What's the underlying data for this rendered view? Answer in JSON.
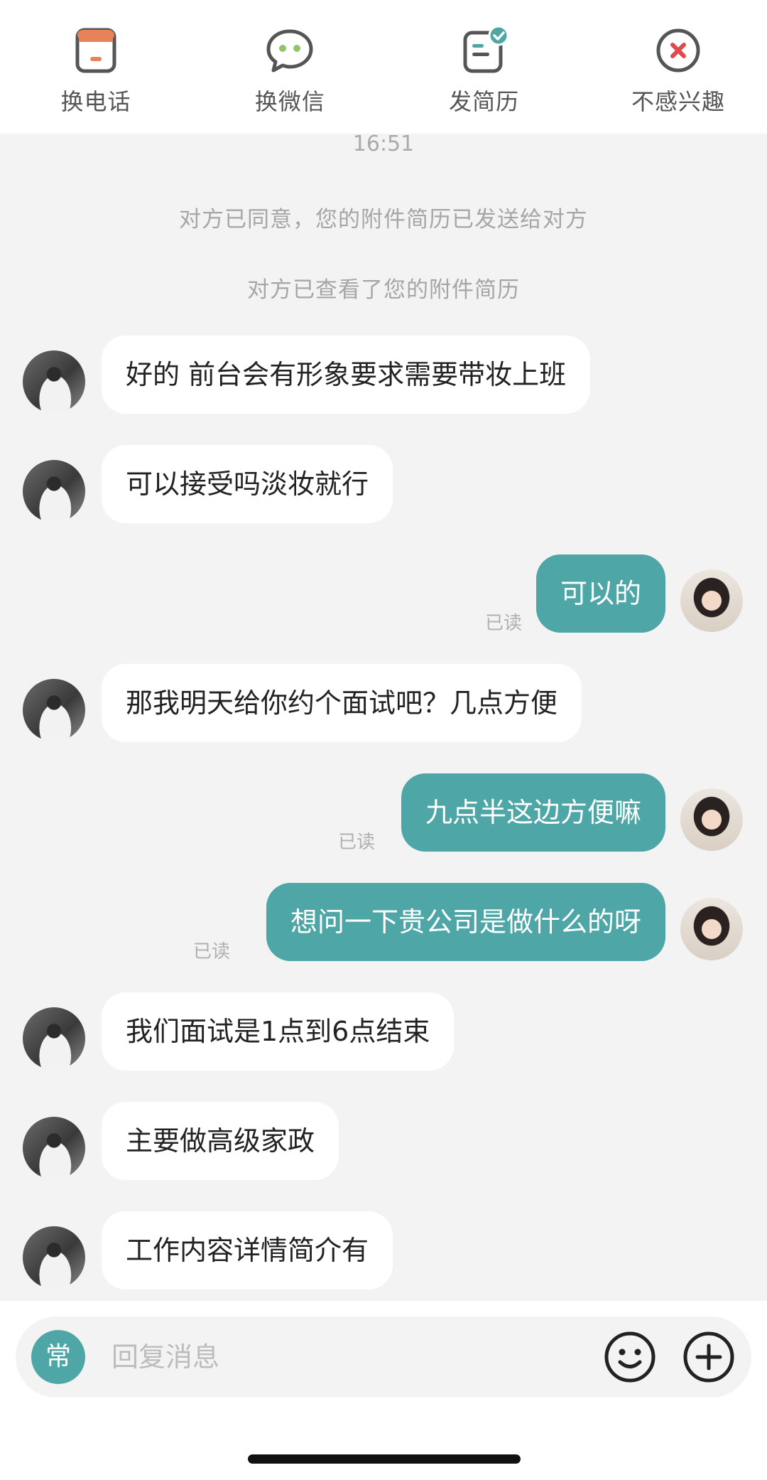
{
  "actions": {
    "phone": "换电话",
    "wechat": "换微信",
    "resume": "发简历",
    "not_interested": "不感兴趣"
  },
  "colors": {
    "accent": "#4fa6a6",
    "orange": "#e8825a",
    "green": "#8fc46a",
    "red": "#e04a4a"
  },
  "chat": {
    "timestamp": "16:51",
    "system": [
      "对方已同意，您的附件简历已发送给对方",
      "对方已查看了您的附件简历"
    ],
    "messages": [
      {
        "from": "other",
        "text": "好的 前台会有形象要求需要带妆上班"
      },
      {
        "from": "other",
        "text": "可以接受吗淡妆就行"
      },
      {
        "from": "me",
        "text": "可以的",
        "status": "已读"
      },
      {
        "from": "other",
        "text": "那我明天给你约个面试吧？几点方便"
      },
      {
        "from": "me",
        "text": "九点半这边方便嘛",
        "status": "已读"
      },
      {
        "from": "me",
        "text": "想问一下贵公司是做什么的呀",
        "status": "已读"
      },
      {
        "from": "other",
        "text": "我们面试是1点到6点结束"
      },
      {
        "from": "other",
        "text": "主要做高级家政"
      },
      {
        "from": "other",
        "text": "工作内容详情简介有"
      }
    ]
  },
  "input": {
    "common_label": "常",
    "placeholder": "回复消息"
  }
}
